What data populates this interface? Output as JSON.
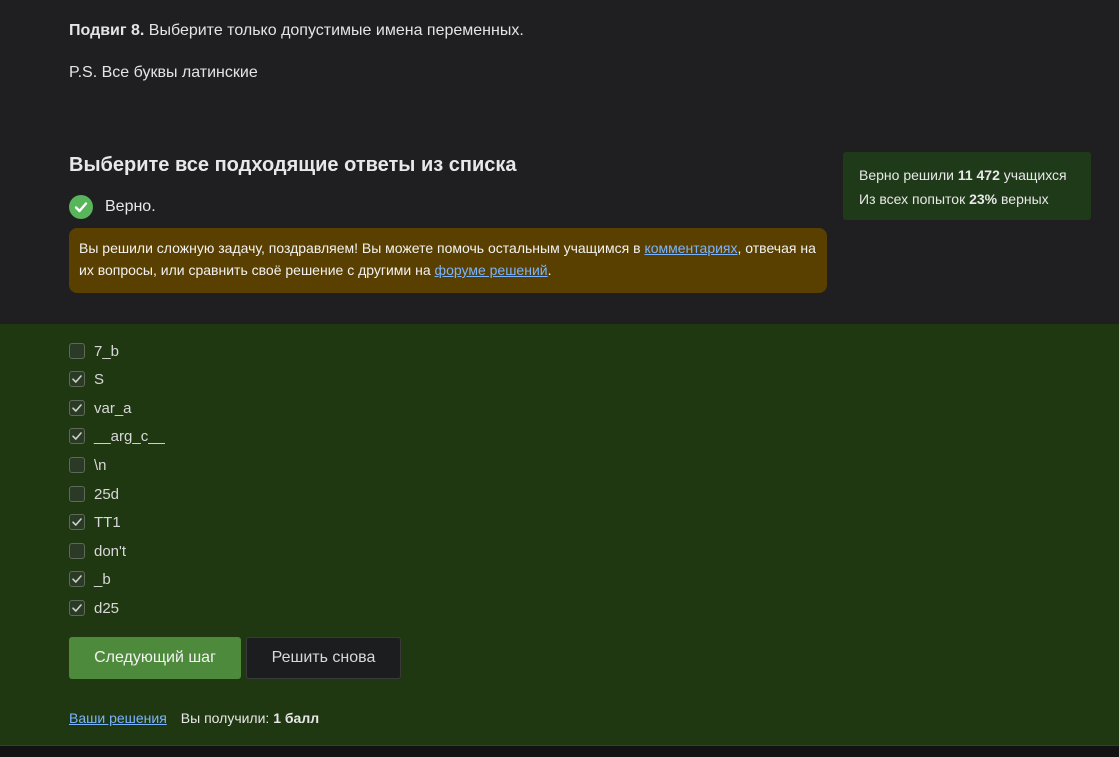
{
  "task": {
    "title_prefix": "Подвиг 8.",
    "title_text": " Выберите только допустимые имена переменных.",
    "ps": "P.S. Все буквы латинские"
  },
  "question": {
    "heading": "Выберите все подходящие ответы из списка",
    "verdict": "Верно."
  },
  "notice": {
    "text_1": "Вы решили сложную задачу, поздравляем! Вы можете помочь остальным учащимся в ",
    "link_comments": "комментариях",
    "text_2": ", отвечая на их вопросы, или сравнить своё решение с другими на ",
    "link_forum": "форуме решений",
    "text_3": "."
  },
  "stats": {
    "solved_prefix": "Верно решили ",
    "solved_count": "11 472",
    "solved_suffix": " учащихся",
    "attempts_prefix": "Из всех попыток ",
    "attempts_percent": "23%",
    "attempts_suffix": " верных"
  },
  "options": [
    {
      "label": "7_b",
      "checked": false
    },
    {
      "label": "S",
      "checked": true
    },
    {
      "label": "var_a",
      "checked": true
    },
    {
      "label": "__arg_c__",
      "checked": true
    },
    {
      "label": "\\n",
      "checked": false
    },
    {
      "label": "25d",
      "checked": false
    },
    {
      "label": "TT1",
      "checked": true
    },
    {
      "label": "don't",
      "checked": false
    },
    {
      "label": "_b",
      "checked": true
    },
    {
      "label": "d25",
      "checked": true
    }
  ],
  "buttons": {
    "next": "Следующий шаг",
    "retry": "Решить снова"
  },
  "footer": {
    "your_solutions": "Ваши решения",
    "score_prefix": "Вы получили: ",
    "score_value": "1 балл"
  },
  "colors": {
    "accent_green": "#4e8a3c",
    "answers_bg": "#1f3812",
    "notice_bg": "#5a4000",
    "link": "#7ab4ff"
  }
}
